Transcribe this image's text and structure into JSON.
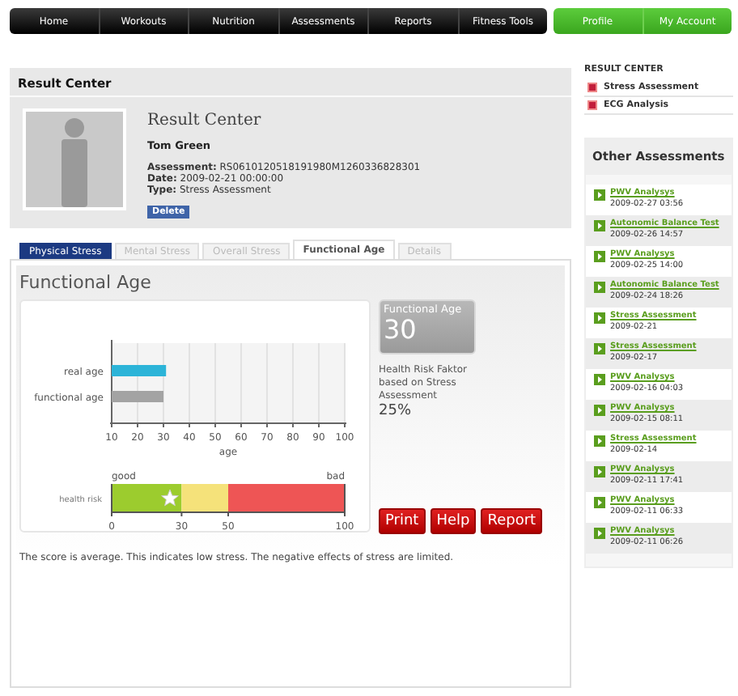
{
  "nav": {
    "main": [
      "Home",
      "Workouts",
      "Nutrition",
      "Assessments",
      "Reports",
      "Fitness Tools"
    ],
    "account": [
      "Profile",
      "My Account"
    ]
  },
  "result_panel": {
    "heading": "Result Center",
    "title": "Result Center",
    "name": "Tom Green",
    "fields": [
      {
        "label": "Assessment:",
        "value": "RS0610120518191980M1260336828301"
      },
      {
        "label": "Date:",
        "value": "2009-02-21 00:00:00"
      },
      {
        "label": "Type:",
        "value": "Stress Assessment"
      }
    ],
    "delete_button": "Delete"
  },
  "tabs": [
    {
      "label": "Physical Stress",
      "selected": false,
      "highlighted": true
    },
    {
      "label": "Mental Stress",
      "selected": false,
      "highlighted": false
    },
    {
      "label": "Overall Stress",
      "selected": false,
      "highlighted": false
    },
    {
      "label": "Functional Age",
      "selected": true,
      "highlighted": false
    },
    {
      "label": "Details",
      "selected": false,
      "highlighted": false
    }
  ],
  "functional_age": {
    "title": "Functional Age",
    "chart_data": {
      "type": "bar",
      "orientation": "horizontal",
      "xlabel": "age",
      "categories": [
        "real age",
        "functional age"
      ],
      "series": [
        {
          "color": "#2cb4d8",
          "values": [
            31,
            null
          ]
        },
        {
          "color": "#a3a3a3",
          "values": [
            null,
            30
          ]
        }
      ],
      "xlim": [
        10,
        100
      ],
      "grid": true,
      "xticks": [
        10,
        20,
        30,
        40,
        50,
        60,
        70,
        80,
        90,
        100
      ]
    },
    "risk_scale": {
      "low_label": "good",
      "high_label": "bad",
      "chart_data": {
        "type": "bar",
        "orientation": "horizontal",
        "stacked": true,
        "categories": [
          "health risk"
        ],
        "series": [
          {
            "color": "#9ccc2e",
            "values": [
              30
            ]
          },
          {
            "color": "#f5e27a",
            "values": [
              20
            ]
          },
          {
            "color": "#ee5555",
            "values": [
              50
            ]
          }
        ],
        "xlim": [
          0,
          100
        ],
        "xticks": [
          0,
          30,
          50,
          100
        ]
      },
      "marker": {
        "level": 0.25
      }
    },
    "score_card": {
      "label": "Functional Age",
      "value": "30"
    },
    "risk_note": "Health Risk Faktor based on Stress Assessment",
    "risk_value": "25%",
    "buttons": [
      "Print",
      "Help",
      "Report"
    ],
    "summary": "The score is average. This indicates low stress. The negative effects of stress are limited."
  },
  "sidebar": {
    "heading": "RESULT CENTER",
    "items": [
      "Stress Assessment",
      "ECG Analysis"
    ]
  },
  "other_assessments": {
    "title": "Other Assessments",
    "items": [
      {
        "name": "PWV Analysys",
        "date": "2009-02-27 03:56"
      },
      {
        "name": "Autonomic Balance Test",
        "date": "2009-02-26 14:57"
      },
      {
        "name": "PWV Analysys",
        "date": "2009-02-25 14:00"
      },
      {
        "name": "Autonomic Balance Test",
        "date": "2009-02-24 18:26"
      },
      {
        "name": "Stress Assessment",
        "date": "2009-02-21"
      },
      {
        "name": "Stress Assessment",
        "date": "2009-02-17"
      },
      {
        "name": "PWV Analysys",
        "date": "2009-02-16 04:03"
      },
      {
        "name": "PWV Analysys",
        "date": "2009-02-15 08:11"
      },
      {
        "name": "Stress Assessment",
        "date": "2009-02-14"
      },
      {
        "name": "PWV Analysys",
        "date": "2009-02-11 17:41"
      },
      {
        "name": "PWV Analysys",
        "date": "2009-02-11 06:33"
      },
      {
        "name": "PWV Analysys",
        "date": "2009-02-11 06:26"
      }
    ]
  }
}
